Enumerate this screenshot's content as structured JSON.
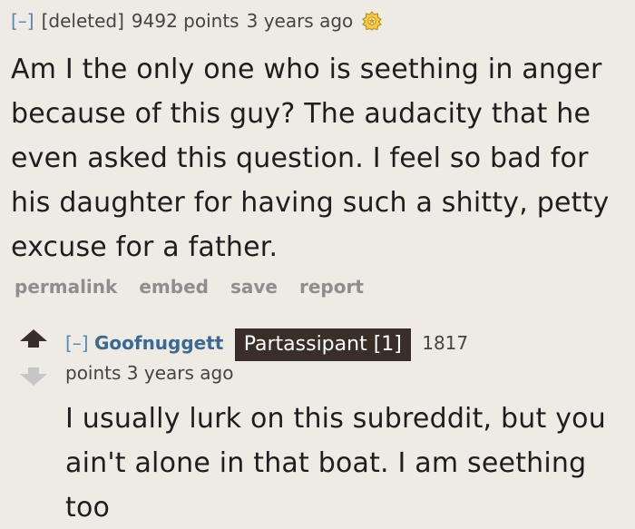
{
  "parent": {
    "expand": "[–]",
    "author": "[deleted]",
    "points": "9492 points",
    "age": "3 years ago",
    "gild_icon": "gilded-award-icon",
    "body": "Am I the only one who is seething in anger because of this guy? The audacity that he even asked this question. I feel so bad for his daughter for having such a shitty, petty excuse for a father.",
    "buttons": [
      "permalink",
      "embed",
      "save",
      "report"
    ]
  },
  "reply": {
    "upvote_icon": "upvote-arrow-icon",
    "downvote_icon": "downvote-arrow-icon",
    "expand": "[–]",
    "author": "Goofnuggett",
    "flair": "Partassipant [1]",
    "score": "1817",
    "points_line": "points 3 years ago",
    "body": "I usually lurk on this subreddit, but you ain't alone in that boat. I am seething too"
  },
  "colors": {
    "background": "#eeebe5",
    "link": "#3b6894",
    "flair_bg": "#3a2f28",
    "muted": "#8e8e8e",
    "upvote": "#3a2f28"
  }
}
